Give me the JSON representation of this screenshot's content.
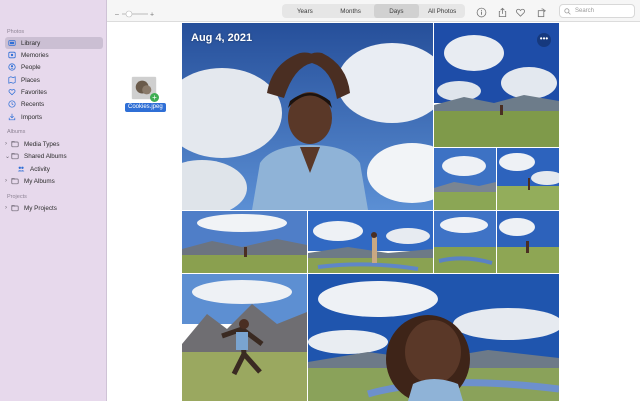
{
  "sidebar": {
    "photos_label": "Photos",
    "library": "Library",
    "memories": "Memories",
    "people": "People",
    "places": "Places",
    "favorites": "Favorites",
    "recents": "Recents",
    "imports": "Imports",
    "albums_label": "Albums",
    "media_types": "Media Types",
    "shared_albums": "Shared Albums",
    "activity": "Activity",
    "my_albums": "My Albums",
    "projects_label": "Projects",
    "my_projects": "My Projects"
  },
  "drag": {
    "filename": "Cookies.jpeg"
  },
  "toolbar": {
    "tabs": [
      "Years",
      "Months",
      "Days",
      "All Photos"
    ],
    "selected_tab": "Days",
    "search_placeholder": "Search"
  },
  "grid": {
    "date_title": "Aug 4, 2021",
    "more_label": "•••"
  },
  "colors": {
    "sidebar_bg": "#e7d9ec",
    "sidebar_selected": "#cbbfd3",
    "accent": "#2f6fd6",
    "sky": "#3f72c6"
  }
}
